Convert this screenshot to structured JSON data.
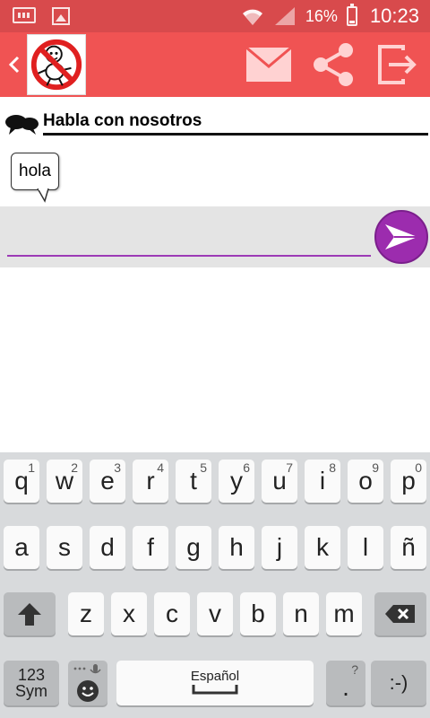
{
  "status_bar": {
    "battery": "16%",
    "time": "10:23",
    "icons": [
      "keyboard-icon",
      "image-icon",
      "wifi-icon",
      "signal-icon",
      "battery-icon"
    ]
  },
  "app_bar": {
    "icons": [
      "back-icon",
      "app-logo",
      "mail-icon",
      "share-icon",
      "exit-icon"
    ],
    "color": "#f05353"
  },
  "chat": {
    "title": "Habla con nosotros",
    "messages": [
      "hola"
    ]
  },
  "composer": {
    "value": "",
    "accent": "#9c2cae"
  },
  "keyboard": {
    "row1": [
      {
        "k": "q",
        "n": "1"
      },
      {
        "k": "w",
        "n": "2"
      },
      {
        "k": "e",
        "n": "3"
      },
      {
        "k": "r",
        "n": "4"
      },
      {
        "k": "t",
        "n": "5"
      },
      {
        "k": "y",
        "n": "6"
      },
      {
        "k": "u",
        "n": "7"
      },
      {
        "k": "i",
        "n": "8"
      },
      {
        "k": "o",
        "n": "9"
      },
      {
        "k": "p",
        "n": "0"
      }
    ],
    "row2": [
      "a",
      "s",
      "d",
      "f",
      "g",
      "h",
      "j",
      "k",
      "l",
      "ñ"
    ],
    "row3": [
      "z",
      "x",
      "c",
      "v",
      "b",
      "n",
      "m"
    ],
    "sym_top": "123",
    "sym_bottom": "Sym",
    "space_label": "Español",
    "period": ".",
    "period_hint": "?",
    "smiley": ":-)"
  }
}
